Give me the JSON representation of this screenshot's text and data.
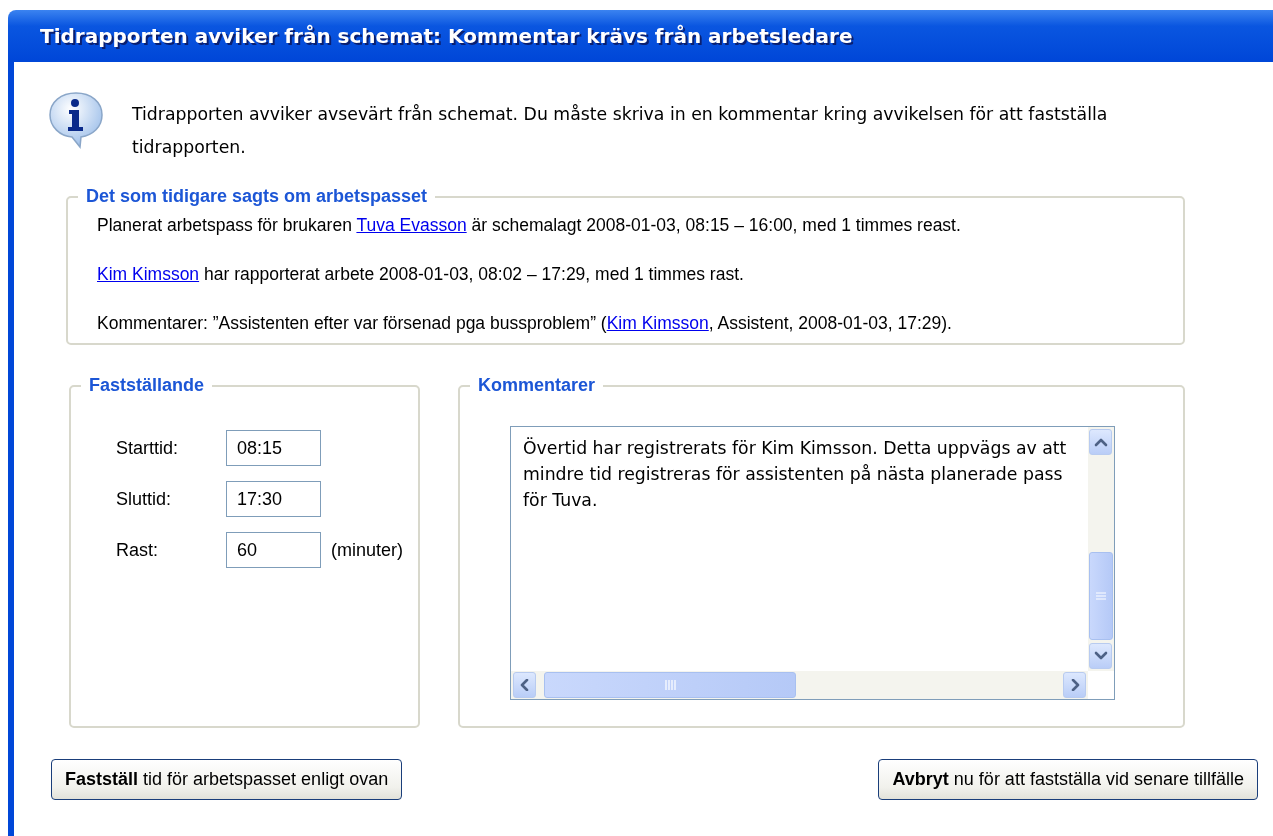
{
  "dialog": {
    "title": "Tidrapporten avviker från schemat: Kommentar krävs från arbetsledare"
  },
  "info": {
    "text": "Tidrapporten avviker avsevärt från schemat. Du måste skriva in en kommentar kring avvikelsen för att fastställa tidrapporten."
  },
  "history": {
    "legend": "Det som tidigare sagts om arbetspasset",
    "paragraphs": [
      [
        {
          "kind": "text",
          "text": "Planerat arbetspass för brukaren "
        },
        {
          "kind": "link",
          "text": "Tuva Evasson"
        },
        {
          "kind": "text",
          "text": " är schemalagt 2008-01-03, 08:15 – 16:00, med 1 timmes reast."
        }
      ],
      [
        {
          "kind": "link",
          "text": "Kim Kimsson"
        },
        {
          "kind": "text",
          "text": " har rapporterat arbete 2008-01-03, 08:02 – 17:29, med 1 timmes rast."
        }
      ],
      [
        {
          "kind": "text",
          "text": "Kommentarer: ”Assistenten efter var försenad pga bussproblem” ("
        },
        {
          "kind": "link",
          "text": "Kim Kimsson"
        },
        {
          "kind": "text",
          "text": ", Assistent, 2008-01-03, 17:29)."
        }
      ]
    ]
  },
  "confirm": {
    "legend": "Fastställande",
    "fields": [
      {
        "label": "Starttid:",
        "value": "08:15"
      },
      {
        "label": "Sluttid:",
        "value": "17:30"
      },
      {
        "label": "Rast:",
        "value": "60",
        "unit": "(minuter)"
      }
    ]
  },
  "comments": {
    "legend": "Kommentarer",
    "value": "Övertid har registrerats för Kim Kimsson. Detta uppvägs av att mindre tid registreras för assistenten på nästa planerade pass för Tuva."
  },
  "buttons": [
    {
      "text": "**Fastställ** tid för arbetspasset enligt ovan"
    },
    {
      "text": "**Avbryt** nu för att fastställa vid senare tillfälle"
    }
  ]
}
